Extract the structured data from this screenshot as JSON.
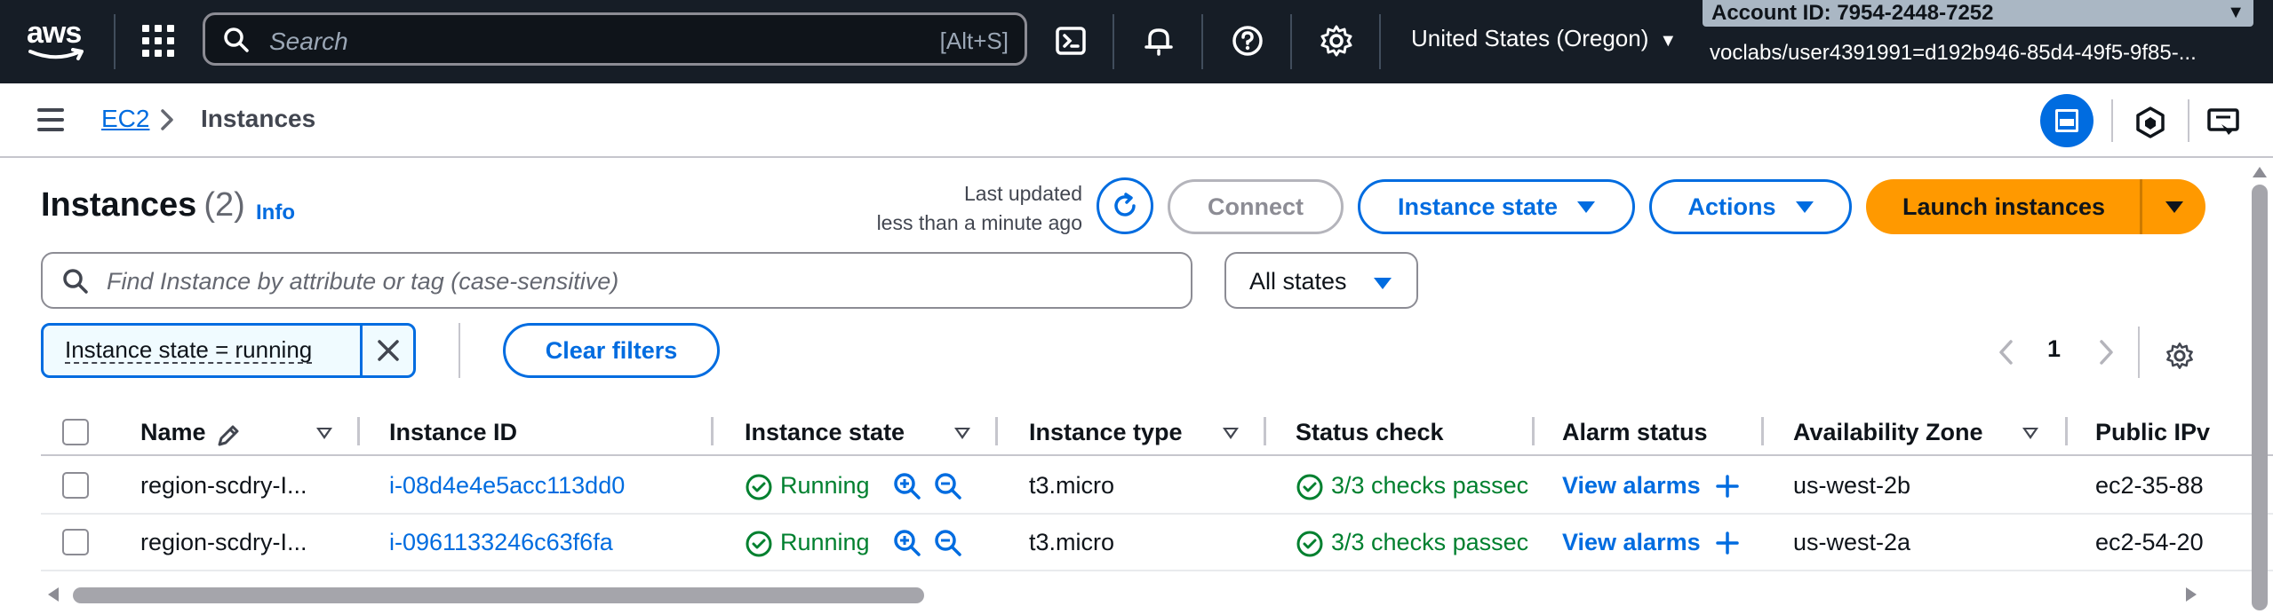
{
  "topnav": {
    "logo": "aws",
    "search_placeholder": "Search",
    "search_shortcut": "[Alt+S]",
    "region": "United States (Oregon)",
    "account_id": "Account ID: 7954-2448-7252",
    "user": "voclabs/user4391991=d192b946-85d4-49f5-9f85-...",
    "icons": [
      "grid-icon",
      "cloudshell-icon",
      "bell-icon",
      "help-icon",
      "gear-icon"
    ]
  },
  "breadcrumb": {
    "root": "EC2",
    "current": "Instances"
  },
  "header": {
    "title": "Instances",
    "count": "(2)",
    "info": "Info",
    "last_updated_line1": "Last updated",
    "last_updated_line2": "less than a minute ago",
    "connect": "Connect",
    "instance_state": "Instance state",
    "actions": "Actions",
    "launch": "Launch instances"
  },
  "filters": {
    "search_placeholder": "Find Instance by attribute or tag (case-sensitive)",
    "state_select": "All states",
    "token": "Instance state = running",
    "clear": "Clear filters"
  },
  "pagination": {
    "page": "1"
  },
  "table": {
    "columns": [
      "Name",
      "Instance ID",
      "Instance state",
      "Instance type",
      "Status check",
      "Alarm status",
      "Availability Zone",
      "Public IPv"
    ],
    "rows": [
      {
        "name": "region-scdry-I...",
        "instance_id": "i-08d4e4e5acc113dd0",
        "state": "Running",
        "type": "t3.micro",
        "status_check": "3/3 checks passec",
        "alarm": "View alarms",
        "az": "us-west-2b",
        "public_ip": "ec2-35-88"
      },
      {
        "name": "region-scdry-I...",
        "instance_id": "i-0961133246c63f6fa",
        "state": "Running",
        "type": "t3.micro",
        "status_check": "3/3 checks passec",
        "alarm": "View alarms",
        "az": "us-west-2a",
        "public_ip": "ec2-54-20"
      }
    ]
  },
  "colors": {
    "nav_bg": "#161d26",
    "link": "#006ce0",
    "primary": "#ff9900",
    "success": "#00802f"
  }
}
